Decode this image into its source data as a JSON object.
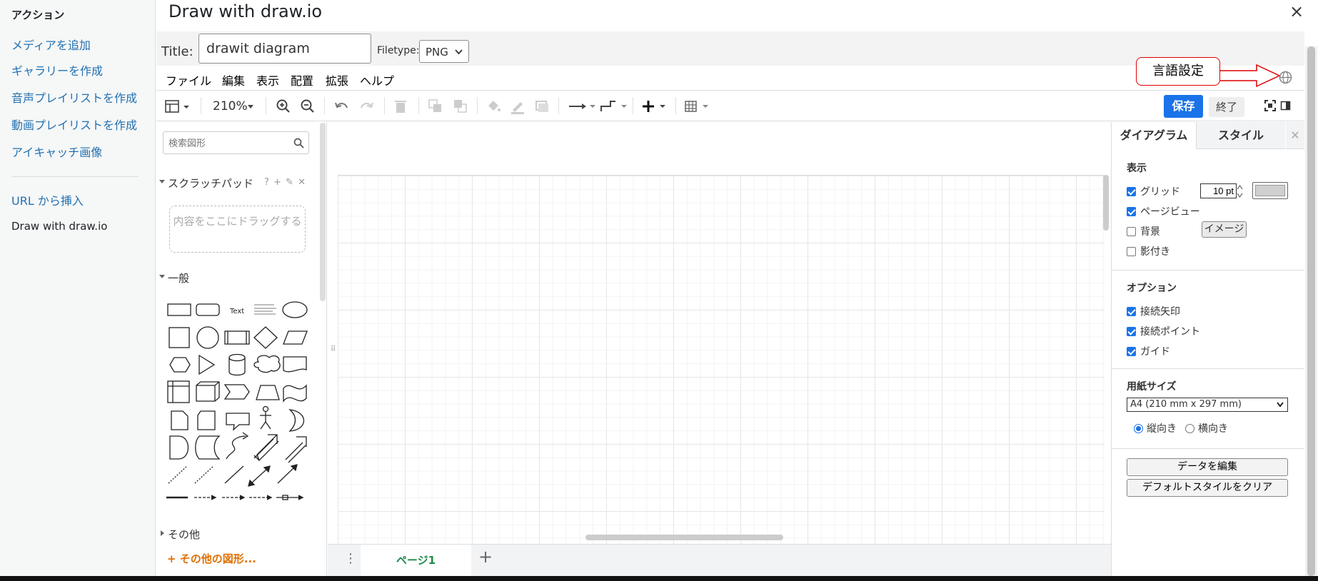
{
  "media_sidebar": {
    "heading": "アクション",
    "links": [
      "メディアを追加",
      "ギャラリーを作成",
      "音声プレイリストを作成",
      "動画プレイリストを作成",
      "アイキャッチ画像"
    ],
    "url_insert": "URL から挿入",
    "current": "Draw with draw.io"
  },
  "modal": {
    "title": "Draw with draw.io",
    "close_icon": "×"
  },
  "title_row": {
    "title_label": "Title:",
    "title_value": "drawit diagram",
    "filetype_label": "Filetype:",
    "filetype_value": "PNG"
  },
  "menubar": {
    "items": [
      "ファイル",
      "編集",
      "表示",
      "配置",
      "拡張",
      "ヘルプ"
    ]
  },
  "toolbar": {
    "zoom": "210%",
    "save_label": "保存",
    "exit_label": "終了"
  },
  "callout": {
    "text": "言語設定"
  },
  "shapes_panel": {
    "search_placeholder": "検索図形",
    "scratchpad_title": "スクラッチパッド",
    "scratchpad_actions": "? + ✎ ✕",
    "scratchpad_drop": "内容をここにドラッグする",
    "general_title": "一般",
    "other_title": "その他",
    "more_shapes": "+ その他の図形..."
  },
  "page_tabs": {
    "tabs": [
      "ページ1"
    ],
    "menu_icon": "⋮",
    "add_icon": "+"
  },
  "format_panel": {
    "tabs": [
      "ダイアグラム",
      "スタイル"
    ],
    "close_icon": "✕",
    "view_heading": "表示",
    "view_options": [
      {
        "label": "グリッド",
        "checked": true
      },
      {
        "label": "ページビュー",
        "checked": true
      },
      {
        "label": "背景",
        "checked": false
      },
      {
        "label": "影付き",
        "checked": false
      }
    ],
    "grid_size": "10 pt",
    "grid_color": "#d0d0d0",
    "image_button": "イメージ",
    "options_heading": "オプション",
    "options": [
      {
        "label": "接続矢印",
        "checked": true
      },
      {
        "label": "接続ポイント",
        "checked": true
      },
      {
        "label": "ガイド",
        "checked": true
      }
    ],
    "paper_heading": "用紙サイズ",
    "paper_size": "A4 (210 mm x 297 mm)",
    "orientation": [
      {
        "label": "縦向き",
        "checked": true
      },
      {
        "label": "横向き",
        "checked": false
      }
    ],
    "edit_data_button": "データを編集",
    "clear_style_button": "デフォルトスタイルをクリア"
  },
  "colors": {
    "accent": "#1a73e8",
    "link": "#2271b1",
    "page_tab": "#1e8a4a",
    "more_shapes": "#e07000",
    "callout_border": "#dd0000"
  }
}
